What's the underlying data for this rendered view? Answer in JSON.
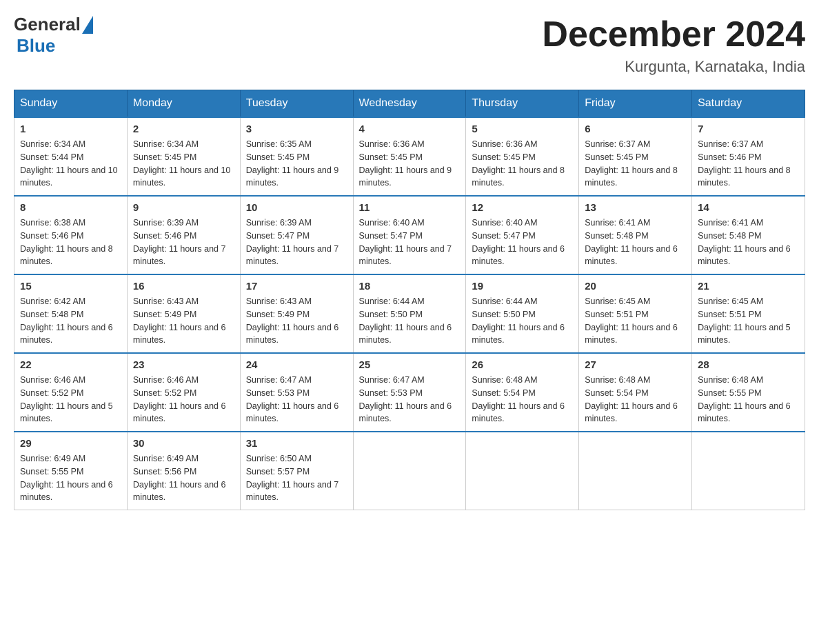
{
  "header": {
    "logo_general": "General",
    "logo_blue": "Blue",
    "title": "December 2024",
    "subtitle": "Kurgunta, Karnataka, India"
  },
  "weekdays": [
    "Sunday",
    "Monday",
    "Tuesday",
    "Wednesday",
    "Thursday",
    "Friday",
    "Saturday"
  ],
  "weeks": [
    [
      {
        "day": "1",
        "sunrise": "6:34 AM",
        "sunset": "5:44 PM",
        "daylight": "11 hours and 10 minutes."
      },
      {
        "day": "2",
        "sunrise": "6:34 AM",
        "sunset": "5:45 PM",
        "daylight": "11 hours and 10 minutes."
      },
      {
        "day": "3",
        "sunrise": "6:35 AM",
        "sunset": "5:45 PM",
        "daylight": "11 hours and 9 minutes."
      },
      {
        "day": "4",
        "sunrise": "6:36 AM",
        "sunset": "5:45 PM",
        "daylight": "11 hours and 9 minutes."
      },
      {
        "day": "5",
        "sunrise": "6:36 AM",
        "sunset": "5:45 PM",
        "daylight": "11 hours and 8 minutes."
      },
      {
        "day": "6",
        "sunrise": "6:37 AM",
        "sunset": "5:45 PM",
        "daylight": "11 hours and 8 minutes."
      },
      {
        "day": "7",
        "sunrise": "6:37 AM",
        "sunset": "5:46 PM",
        "daylight": "11 hours and 8 minutes."
      }
    ],
    [
      {
        "day": "8",
        "sunrise": "6:38 AM",
        "sunset": "5:46 PM",
        "daylight": "11 hours and 8 minutes."
      },
      {
        "day": "9",
        "sunrise": "6:39 AM",
        "sunset": "5:46 PM",
        "daylight": "11 hours and 7 minutes."
      },
      {
        "day": "10",
        "sunrise": "6:39 AM",
        "sunset": "5:47 PM",
        "daylight": "11 hours and 7 minutes."
      },
      {
        "day": "11",
        "sunrise": "6:40 AM",
        "sunset": "5:47 PM",
        "daylight": "11 hours and 7 minutes."
      },
      {
        "day": "12",
        "sunrise": "6:40 AM",
        "sunset": "5:47 PM",
        "daylight": "11 hours and 6 minutes."
      },
      {
        "day": "13",
        "sunrise": "6:41 AM",
        "sunset": "5:48 PM",
        "daylight": "11 hours and 6 minutes."
      },
      {
        "day": "14",
        "sunrise": "6:41 AM",
        "sunset": "5:48 PM",
        "daylight": "11 hours and 6 minutes."
      }
    ],
    [
      {
        "day": "15",
        "sunrise": "6:42 AM",
        "sunset": "5:48 PM",
        "daylight": "11 hours and 6 minutes."
      },
      {
        "day": "16",
        "sunrise": "6:43 AM",
        "sunset": "5:49 PM",
        "daylight": "11 hours and 6 minutes."
      },
      {
        "day": "17",
        "sunrise": "6:43 AM",
        "sunset": "5:49 PM",
        "daylight": "11 hours and 6 minutes."
      },
      {
        "day": "18",
        "sunrise": "6:44 AM",
        "sunset": "5:50 PM",
        "daylight": "11 hours and 6 minutes."
      },
      {
        "day": "19",
        "sunrise": "6:44 AM",
        "sunset": "5:50 PM",
        "daylight": "11 hours and 6 minutes."
      },
      {
        "day": "20",
        "sunrise": "6:45 AM",
        "sunset": "5:51 PM",
        "daylight": "11 hours and 6 minutes."
      },
      {
        "day": "21",
        "sunrise": "6:45 AM",
        "sunset": "5:51 PM",
        "daylight": "11 hours and 5 minutes."
      }
    ],
    [
      {
        "day": "22",
        "sunrise": "6:46 AM",
        "sunset": "5:52 PM",
        "daylight": "11 hours and 5 minutes."
      },
      {
        "day": "23",
        "sunrise": "6:46 AM",
        "sunset": "5:52 PM",
        "daylight": "11 hours and 6 minutes."
      },
      {
        "day": "24",
        "sunrise": "6:47 AM",
        "sunset": "5:53 PM",
        "daylight": "11 hours and 6 minutes."
      },
      {
        "day": "25",
        "sunrise": "6:47 AM",
        "sunset": "5:53 PM",
        "daylight": "11 hours and 6 minutes."
      },
      {
        "day": "26",
        "sunrise": "6:48 AM",
        "sunset": "5:54 PM",
        "daylight": "11 hours and 6 minutes."
      },
      {
        "day": "27",
        "sunrise": "6:48 AM",
        "sunset": "5:54 PM",
        "daylight": "11 hours and 6 minutes."
      },
      {
        "day": "28",
        "sunrise": "6:48 AM",
        "sunset": "5:55 PM",
        "daylight": "11 hours and 6 minutes."
      }
    ],
    [
      {
        "day": "29",
        "sunrise": "6:49 AM",
        "sunset": "5:55 PM",
        "daylight": "11 hours and 6 minutes."
      },
      {
        "day": "30",
        "sunrise": "6:49 AM",
        "sunset": "5:56 PM",
        "daylight": "11 hours and 6 minutes."
      },
      {
        "day": "31",
        "sunrise": "6:50 AM",
        "sunset": "5:57 PM",
        "daylight": "11 hours and 7 minutes."
      },
      null,
      null,
      null,
      null
    ]
  ],
  "labels": {
    "sunrise": "Sunrise:",
    "sunset": "Sunset:",
    "daylight": "Daylight:"
  }
}
